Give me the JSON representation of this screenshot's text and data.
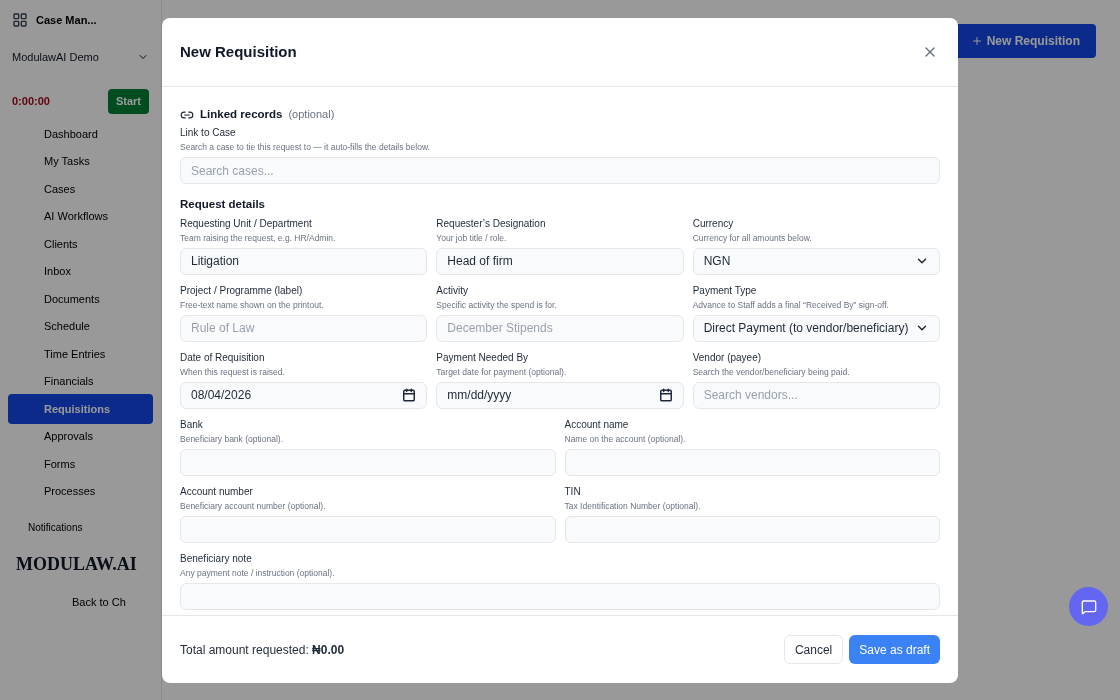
{
  "background": {
    "app_title": "Case Man...",
    "workspace": "ModulawAI Demo",
    "timer": "0:00:00",
    "timer_button": "Start",
    "nav": [
      {
        "label": "Dashboard",
        "selected": false
      },
      {
        "label": "My Tasks",
        "selected": false
      },
      {
        "label": "Cases",
        "selected": false
      },
      {
        "label": "AI Workflows",
        "selected": false
      },
      {
        "label": "Clients",
        "selected": false
      },
      {
        "label": "Inbox",
        "selected": false
      },
      {
        "label": "Documents",
        "selected": false
      },
      {
        "label": "Schedule",
        "selected": false
      },
      {
        "label": "Time Entries",
        "selected": false
      },
      {
        "label": "Financials",
        "selected": false
      },
      {
        "label": "Requisitions",
        "selected": true
      },
      {
        "label": "Approvals",
        "selected": false
      },
      {
        "label": "Forms",
        "selected": false
      },
      {
        "label": "Processes",
        "selected": false
      }
    ],
    "notifications": "Notifications",
    "logo": "MODULAW.AI",
    "back_link": "Back to Ch",
    "new_button": "New Requisition"
  },
  "dialog": {
    "title": "New Requisition",
    "sections": [
      {
        "title": "Linked records",
        "note": "(optional)",
        "rows": [
          [
            {
              "label": "Link to Case",
              "hint": "Search a case to tie this request to — it auto-fills the details below.",
              "kind": "search",
              "placeholder": "Search cases..."
            }
          ]
        ]
      },
      {
        "title": "Request details",
        "rows": [
          [
            {
              "label": "Requesting Unit / Department",
              "hint": "Team raising the request, e.g. HR/Admin.",
              "kind": "text",
              "value": "Litigation"
            },
            {
              "label": "Requester’s Designation",
              "hint": "Your job title / role.",
              "kind": "text",
              "value": "Head of firm"
            },
            {
              "label": "Currency",
              "hint": "Currency for all amounts below.",
              "kind": "select",
              "value": "NGN"
            }
          ],
          [
            {
              "label": "Project / Programme (label)",
              "hint": "Free-text name shown on the printout.",
              "kind": "text",
              "placeholder": "Rule of Law"
            },
            {
              "label": "Activity",
              "hint": "Specific activity the spend is for.",
              "kind": "text",
              "placeholder": "December Stipends"
            },
            {
              "label": "Payment Type",
              "hint": "Advance to Staff adds a final “Received By” sign-off.",
              "kind": "select",
              "value": "Direct Payment (to vendor/beneficiary)"
            }
          ],
          [
            {
              "label": "Date of Requisition",
              "hint": "When this request is raised.",
              "kind": "date",
              "value": "08/04/2026"
            },
            {
              "label": "Payment Needed By",
              "hint": "Target date for payment (optional).",
              "kind": "date",
              "value": "mm/dd/yyyy"
            },
            {
              "label": "Vendor (payee)",
              "hint": "Search the vendor/beneficiary being paid.",
              "kind": "search",
              "placeholder": "Search vendors..."
            }
          ],
          [
            {
              "label": "Bank",
              "hint": "Beneficiary bank (optional).",
              "kind": "text"
            },
            {
              "label": "Account name",
              "hint": "Name on the account (optional).",
              "kind": "text"
            }
          ],
          [
            {
              "label": "Account number",
              "hint": "Beneficiary account number (optional).",
              "kind": "text"
            },
            {
              "label": "TIN",
              "hint": "Tax Identification Number (optional).",
              "kind": "text"
            }
          ],
          [
            {
              "label": "Beneficiary note",
              "hint": "Any payment note / instruction (optional).",
              "kind": "text"
            }
          ]
        ]
      }
    ],
    "total": "Total amount requested: **₦0.00**",
    "buttons": [
      {
        "label": "Cancel",
        "kind": "secondary"
      },
      {
        "label": "Save as draft",
        "kind": "primary"
      }
    ]
  }
}
